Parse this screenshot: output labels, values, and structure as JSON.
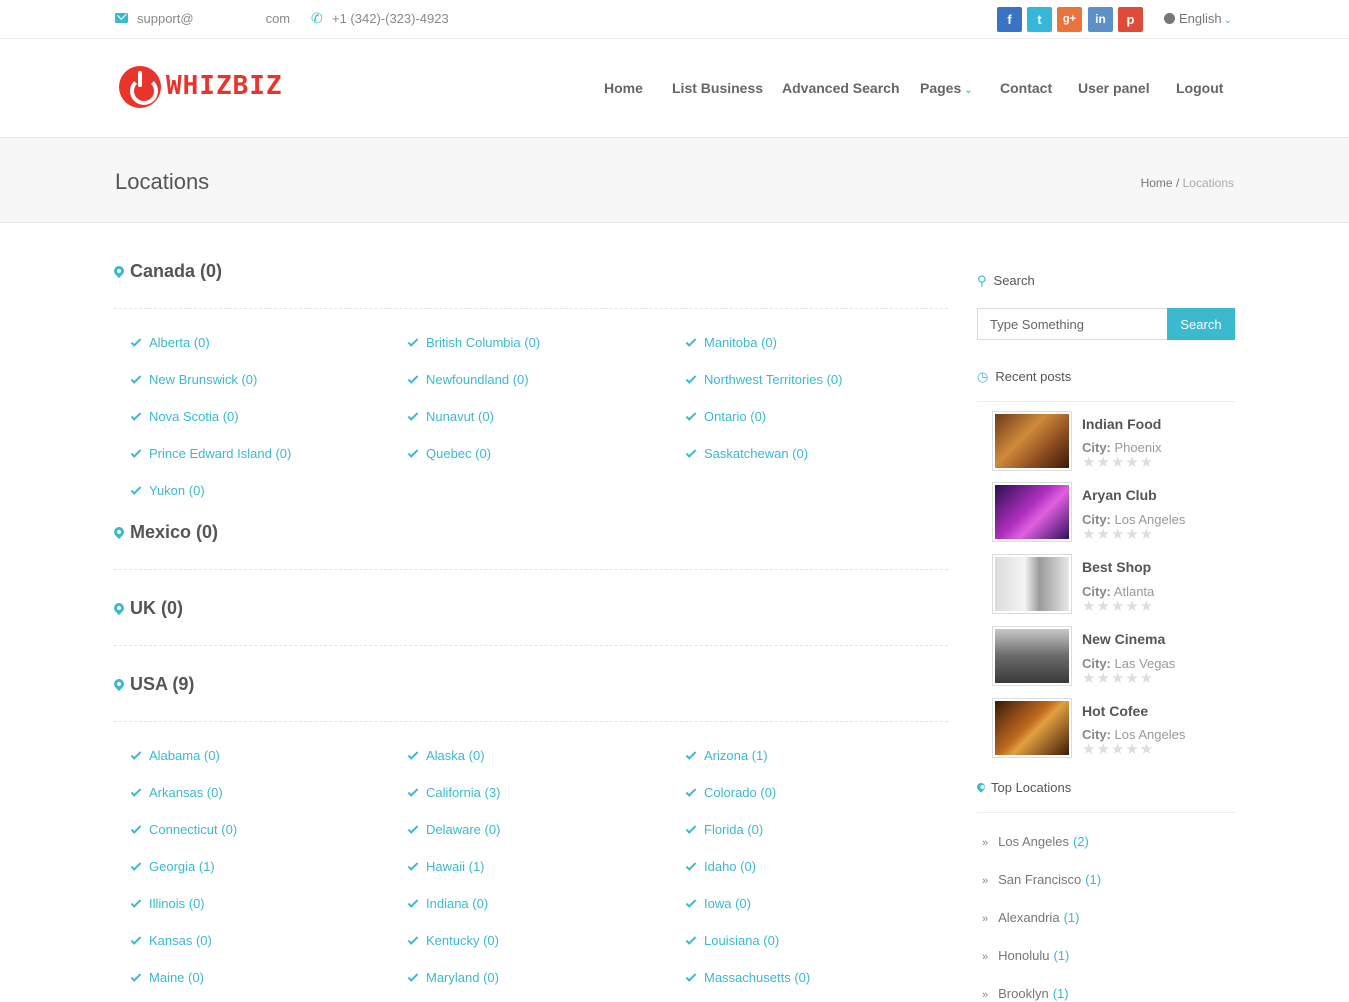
{
  "topbar": {
    "email_prefix": "support@",
    "email_suffix": "com",
    "phone": "+1 (342)-(323)-4923",
    "language": "English",
    "social": [
      {
        "name": "facebook",
        "glyph": "f",
        "color": "#3b73c4"
      },
      {
        "name": "twitter",
        "glyph": "t",
        "color": "#36b6d9"
      },
      {
        "name": "google-plus",
        "glyph": "g+",
        "color": "#e8733d"
      },
      {
        "name": "linkedin",
        "glyph": "in",
        "color": "#5b90c9"
      },
      {
        "name": "pinterest",
        "glyph": "p",
        "color": "#dd4b39"
      }
    ]
  },
  "header": {
    "logo_text": "WHIZBIZ",
    "nav": [
      "Home",
      "List Business",
      "Advanced Search",
      "Pages",
      "Contact",
      "User panel",
      "Logout"
    ]
  },
  "titlebar": {
    "title": "Locations",
    "breadcrumb_home": "Home",
    "breadcrumb_sep": " / ",
    "breadcrumb_current": "Locations"
  },
  "countries": [
    {
      "label": "Canada (0)",
      "regions": [
        "Alberta (0)",
        "British Columbia (0)",
        "Manitoba (0)",
        "New Brunswick (0)",
        "Newfoundland (0)",
        "Northwest Territories (0)",
        "Nova Scotia (0)",
        "Nunavut (0)",
        "Ontario (0)",
        "Prince Edward Island (0)",
        "Quebec (0)",
        "Saskatchewan (0)",
        "Yukon (0)"
      ]
    },
    {
      "label": "Mexico (0)",
      "regions": []
    },
    {
      "label": "UK (0)",
      "regions": []
    },
    {
      "label": "USA (9)",
      "regions": [
        "Alabama (0)",
        "Alaska (0)",
        "Arizona (1)",
        "Arkansas (0)",
        "California (3)",
        "Colorado (0)",
        "Connecticut (0)",
        "Delaware (0)",
        "Florida (0)",
        "Georgia (1)",
        "Hawaii (1)",
        "Idaho (0)",
        "Illinois (0)",
        "Indiana (0)",
        "Iowa (0)",
        "Kansas (0)",
        "Kentucky (0)",
        "Louisiana (0)",
        "Maine (0)",
        "Maryland (0)",
        "Massachusetts (0)"
      ]
    }
  ],
  "sidebar": {
    "search_heading": "Search",
    "search_placeholder": "Type Something",
    "search_button": "Search",
    "recent_heading": "Recent posts",
    "city_label": "City:",
    "posts": [
      {
        "title": "Indian Food",
        "city": "Phoenix",
        "rating": 0
      },
      {
        "title": "Aryan Club",
        "city": "Los Angeles",
        "rating": 0
      },
      {
        "title": "Best Shop",
        "city": "Atlanta",
        "rating": 0
      },
      {
        "title": "New Cinema",
        "city": "Las Vegas",
        "rating": 0
      },
      {
        "title": "Hot Cofee",
        "city": "Los Angeles",
        "rating": 0
      }
    ],
    "top_heading": "Top Locations",
    "top_locations": [
      {
        "name": "Los Angeles",
        "count": "(2)"
      },
      {
        "name": "San Francisco",
        "count": "(1)"
      },
      {
        "name": "Alexandria",
        "count": "(1)"
      },
      {
        "name": "Honolulu",
        "count": "(1)"
      },
      {
        "name": "Brooklyn",
        "count": "(1)"
      }
    ]
  },
  "colors": {
    "accent": "#3bb9cf",
    "brand": "#e8342a"
  }
}
